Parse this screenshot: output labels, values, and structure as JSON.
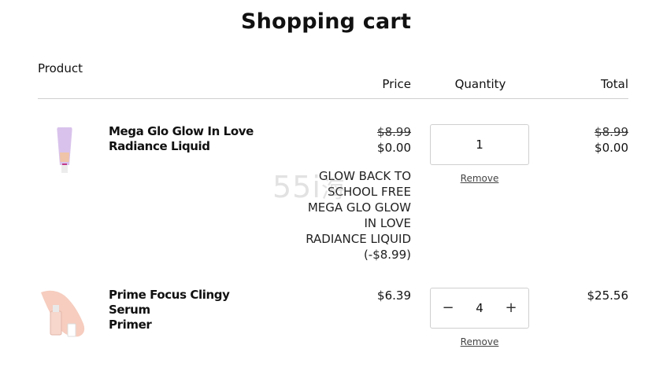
{
  "page": {
    "title": "Shopping cart"
  },
  "table_headers": {
    "product": "Product",
    "price": "Price",
    "quantity": "Quantity",
    "total": "Total"
  },
  "items": [
    {
      "name_line1": "Mega Glo Glow In Love",
      "name_line2": "Radiance Liquid",
      "original_price": "$8.99",
      "price": "$0.00",
      "discount_lines": [
        "GLOW BACK TO",
        "SCHOOL FREE",
        "MEGA GLO GLOW",
        "IN LOVE",
        "RADIANCE LIQUID",
        "(-$8.99)"
      ],
      "quantity": "1",
      "remove_label": "Remove",
      "original_total": "$8.99",
      "total": "$0.00"
    },
    {
      "name_line1": "Prime Focus Clingy Serum",
      "name_line2": "Primer",
      "price": "$6.39",
      "quantity": "4",
      "decrement_symbol": "−",
      "increment_symbol": "+",
      "remove_label": "Remove",
      "total": "$25.56"
    }
  ],
  "watermark": "55i海"
}
